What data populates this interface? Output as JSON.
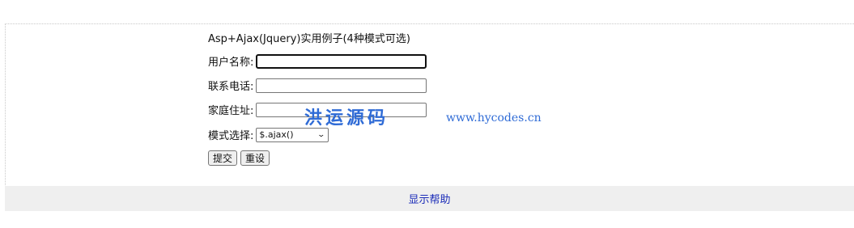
{
  "form": {
    "title": "Asp+Ajax(Jquery)实用例子(4种模式可选)",
    "username_label": "用户名称:",
    "username_value": "",
    "phone_label": "联系电话:",
    "phone_value": "",
    "address_label": "家庭住址:",
    "address_value": "",
    "mode_label": "模式选择:",
    "mode_selected": "$.ajax()",
    "submit_label": "提交",
    "reset_label": "重设"
  },
  "watermark": {
    "brand": "洪运源码",
    "url": "www.hycodes.cn"
  },
  "footer": {
    "help_link": "显示帮助"
  },
  "colors": {
    "watermark": "#2f6bd6",
    "link": "#1a2bb8",
    "footer_bg": "#efefef"
  }
}
